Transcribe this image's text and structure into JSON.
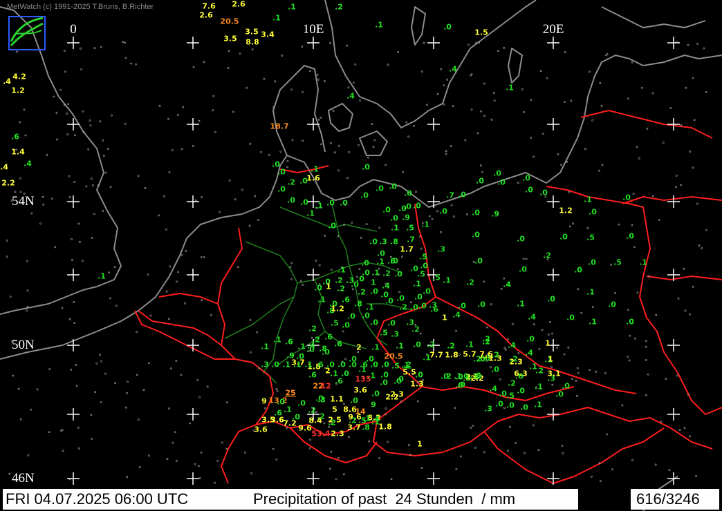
{
  "copyright": "MetWatch  (c) 1991-2025 T.Bruns, B.Richter",
  "footer": {
    "date": "FRI 04.07.2025 06:00 UTC",
    "title": "Precipitation of past  24 Stunden  / mm",
    "station_count": "616/3246"
  },
  "longitude_labels": [
    "0",
    "10E",
    "20E"
  ],
  "latitude_labels": [
    "54N",
    "50N",
    "46N"
  ],
  "colors": {
    "background": "#000000",
    "coastline": "#8c8c8c",
    "borders": "#ff1e1e",
    "german_states": "#1e7a1e",
    "grid": "#ffffff",
    "low_precip": "#22e022",
    "medium_precip": "#ffff33",
    "high_precip": "#ff8c1a",
    "very_high_precip": "#ff3030"
  },
  "stations": [
    {
      "v": "7.6",
      "c": "y"
    },
    {
      "v": "2.6",
      "c": "y"
    },
    {
      "v": "2.6",
      "c": "y"
    },
    {
      "v": "20.5",
      "c": "o"
    },
    {
      "v": "3.5",
      "c": "y"
    },
    {
      "v": "3.4",
      "c": "y"
    },
    {
      "v": "3.5",
      "c": "y"
    },
    {
      "v": "8.8",
      "c": "y"
    },
    {
      "v": ".1",
      "c": "g"
    },
    {
      "v": ".1",
      "c": "g"
    },
    {
      "v": ".2",
      "c": "g"
    },
    {
      "v": ".1",
      "c": "g"
    },
    {
      "v": ".0",
      "c": "g"
    },
    {
      "v": "1.5",
      "c": "y"
    },
    {
      "v": ".4",
      "c": "g"
    },
    {
      "v": ".1",
      "c": "g"
    },
    {
      "v": ".4",
      "c": "g"
    },
    {
      "v": "4.2",
      "c": "y"
    },
    {
      "v": "1.2",
      "c": "y"
    },
    {
      "v": ".4",
      "c": "y"
    },
    {
      "v": ".6",
      "c": "g"
    },
    {
      "v": "1.4",
      "c": "y"
    },
    {
      "v": ".4",
      "c": "g"
    },
    {
      "v": "2.2",
      "c": "y"
    },
    {
      "v": ".4",
      "c": "y"
    },
    {
      "v": "18.7",
      "c": "o"
    },
    {
      "v": ".0",
      "c": "g"
    },
    {
      "v": ".1",
      "c": "g"
    },
    {
      "v": ".0",
      "c": "g"
    },
    {
      "v": ".2",
      "c": "g"
    },
    {
      "v": ".0",
      "c": "g"
    },
    {
      "v": "1.6",
      "c": "y"
    },
    {
      "v": ".0",
      "c": "g"
    },
    {
      "v": ".0",
      "c": "g"
    },
    {
      "v": ".0",
      "c": "g"
    },
    {
      "v": ".1",
      "c": "g"
    },
    {
      "v": ".0",
      "c": "g"
    },
    {
      "v": ".0",
      "c": "g"
    },
    {
      "v": ".1",
      "c": "g"
    },
    {
      "v": ".0",
      "c": "g"
    },
    {
      "v": ".0",
      "c": "g"
    },
    {
      "v": ".0",
      "c": "g"
    },
    {
      "v": ".0",
      "c": "g"
    },
    {
      "v": ".0",
      "c": "g"
    },
    {
      "v": ".0",
      "c": "g"
    },
    {
      "v": ".0",
      "c": "g"
    },
    {
      "v": ".0",
      "c": "g"
    },
    {
      "v": ".0",
      "c": "g"
    },
    {
      "v": ".0",
      "c": "g"
    },
    {
      "v": ".0",
      "c": "g"
    },
    {
      "v": ".0",
      "c": "g"
    },
    {
      "v": ".0",
      "c": "g"
    },
    {
      "v": ".0",
      "c": "g"
    },
    {
      "v": ".0",
      "c": "g"
    },
    {
      "v": ".7",
      "c": "g"
    },
    {
      "v": ".0",
      "c": "g"
    },
    {
      "v": ".0",
      "c": "g"
    },
    {
      "v": ".0",
      "c": "g"
    },
    {
      "v": ".9",
      "c": "g"
    },
    {
      "v": ".0",
      "c": "g"
    },
    {
      "v": ".0",
      "c": "g"
    },
    {
      "v": "1.2",
      "c": "y"
    },
    {
      "v": ".1",
      "c": "g"
    },
    {
      "v": ".0",
      "c": "g"
    },
    {
      "v": ".0",
      "c": "g"
    },
    {
      "v": ".5",
      "c": "g"
    },
    {
      "v": ".0",
      "c": "g"
    },
    {
      "v": ".0",
      "c": "g"
    },
    {
      "v": ".0",
      "c": "g"
    },
    {
      "v": ".0",
      "c": "g"
    },
    {
      "v": ".9",
      "c": "g"
    },
    {
      "v": ".5",
      "c": "g"
    },
    {
      "v": ".1",
      "c": "g"
    },
    {
      "v": ".1",
      "c": "g"
    },
    {
      "v": ".0",
      "c": "g"
    },
    {
      "v": ".3",
      "c": "g"
    },
    {
      "v": ".8",
      "c": "g"
    },
    {
      "v": ".7",
      "c": "g"
    },
    {
      "v": "1.7",
      "c": "y"
    },
    {
      "v": ".3",
      "c": "g"
    },
    {
      "v": ".5",
      "c": "g"
    },
    {
      "v": ".0",
      "c": "g"
    },
    {
      "v": ".1",
      "c": "g"
    },
    {
      "v": ".6",
      "c": "g"
    },
    {
      "v": ".0",
      "c": "g"
    },
    {
      "v": ".0",
      "c": "g"
    },
    {
      "v": ".0",
      "c": "g"
    },
    {
      "v": ".0",
      "c": "g"
    },
    {
      "v": ".0",
      "c": "g"
    },
    {
      "v": ".1",
      "c": "g"
    },
    {
      "v": ".0",
      "c": "g"
    },
    {
      "v": ".2",
      "c": "g"
    },
    {
      "v": ".0",
      "c": "g"
    },
    {
      "v": ".1",
      "c": "g"
    },
    {
      "v": ".2",
      "c": "g"
    },
    {
      "v": ".3",
      "c": "g"
    },
    {
      "v": ".0",
      "c": "g"
    },
    {
      "v": "1",
      "c": "g"
    },
    {
      "v": ".4",
      "c": "g"
    },
    {
      "v": ".5",
      "c": "g"
    },
    {
      "v": ".5",
      "c": "g"
    },
    {
      "v": ".1",
      "c": "g"
    },
    {
      "v": ".2",
      "c": "g"
    },
    {
      "v": ".0",
      "c": "g"
    },
    {
      "v": ".2",
      "c": "g"
    },
    {
      "v": ".0",
      "c": "g"
    },
    {
      "v": ".4",
      "c": "g"
    },
    {
      "v": ".0",
      "c": "g"
    },
    {
      "v": ".0",
      "c": "g"
    },
    {
      "v": "1",
      "c": "y"
    },
    {
      "v": ".2",
      "c": "g"
    },
    {
      "v": ".0",
      "c": "g"
    },
    {
      "v": ".2",
      "c": "g"
    },
    {
      "v": ".0",
      "c": "g"
    },
    {
      "v": ".0",
      "c": "g"
    },
    {
      "v": ".0",
      "c": "g"
    },
    {
      "v": ".1",
      "c": "g"
    },
    {
      "v": ".0",
      "c": "g"
    },
    {
      "v": ".0",
      "c": "g"
    },
    {
      "v": ".0",
      "c": "g"
    },
    {
      "v": ".0",
      "c": "g"
    },
    {
      "v": ".2",
      "c": "g"
    },
    {
      "v": ".0",
      "c": "g"
    },
    {
      "v": ".3",
      "c": "g"
    },
    {
      "v": ".6",
      "c": "g"
    },
    {
      "v": "1",
      "c": "y"
    },
    {
      "v": ".4",
      "c": "g"
    },
    {
      "v": ".0",
      "c": "g"
    },
    {
      "v": ".0",
      "c": "g"
    },
    {
      "v": ".1",
      "c": "g"
    },
    {
      "v": ".0",
      "c": "g"
    },
    {
      "v": ".1",
      "c": "g"
    },
    {
      "v": ".0",
      "c": "g"
    },
    {
      "v": ".8",
      "c": "g"
    },
    {
      "v": ".6",
      "c": "g"
    },
    {
      "v": ".0",
      "c": "g"
    },
    {
      "v": ".1",
      "c": "g"
    },
    {
      "v": ".8",
      "c": "g"
    },
    {
      "v": "1.2",
      "c": "y"
    },
    {
      "v": ".1",
      "c": "g"
    },
    {
      "v": ".0",
      "c": "g"
    },
    {
      "v": ".0",
      "c": "g"
    },
    {
      "v": ".0",
      "c": "g"
    },
    {
      "v": ".3",
      "c": "g"
    },
    {
      "v": ".0",
      "c": "g"
    },
    {
      "v": ".5",
      "c": "g"
    },
    {
      "v": ".0",
      "c": "g"
    },
    {
      "v": ".5",
      "c": "g"
    },
    {
      "v": ".3",
      "c": "g"
    },
    {
      "v": ".2",
      "c": "g"
    },
    {
      "v": ".2",
      "c": "g"
    },
    {
      "v": ".1",
      "c": "g"
    },
    {
      "v": ".0",
      "c": "g"
    },
    {
      "v": ".2",
      "c": "g"
    },
    {
      "v": ".1",
      "c": "g"
    },
    {
      "v": ".2",
      "c": "g"
    },
    {
      "v": ".1",
      "c": "g"
    },
    {
      "v": "2",
      "c": "y"
    },
    {
      "v": ".6",
      "c": "g"
    },
    {
      "v": ".6",
      "c": "g"
    },
    {
      "v": ".2",
      "c": "g"
    },
    {
      "v": ".2",
      "c": "g"
    },
    {
      "v": ".8",
      "c": "g"
    },
    {
      "v": ".4",
      "c": "g"
    },
    {
      "v": ".1",
      "c": "g"
    },
    {
      "v": ".6",
      "c": "g"
    },
    {
      "v": ".1",
      "c": "g"
    },
    {
      "v": ".1",
      "c": "g"
    },
    {
      "v": ".0",
      "c": "g"
    },
    {
      "v": ".0",
      "c": "g"
    },
    {
      "v": ".0",
      "c": "g"
    },
    {
      "v": ".9",
      "c": "g"
    },
    {
      "v": "3.7",
      "c": "y"
    },
    {
      "v": "1.8",
      "c": "y"
    },
    {
      "v": "2",
      "c": "y"
    },
    {
      "v": ".0",
      "c": "g"
    },
    {
      "v": ".1",
      "c": "g"
    },
    {
      "v": ".1",
      "c": "g"
    },
    {
      "v": ".0",
      "c": "g"
    },
    {
      "v": ".1",
      "c": "g"
    },
    {
      "v": ".0",
      "c": "g"
    },
    {
      "v": ".0",
      "c": "g"
    },
    {
      "v": "1.3",
      "c": "y"
    },
    {
      "v": ".0",
      "c": "g"
    },
    {
      "v": ".0",
      "c": "g"
    },
    {
      "v": ".1",
      "c": "g"
    },
    {
      "v": ".0",
      "c": "g"
    },
    {
      "v": ".0",
      "c": "g"
    },
    {
      "v": ".0",
      "c": "g"
    },
    {
      "v": ".0",
      "c": "g"
    },
    {
      "v": ".2",
      "c": "g"
    },
    {
      "v": ".0",
      "c": "g"
    },
    {
      "v": "20.5",
      "c": "o"
    },
    {
      "v": ".5",
      "c": "g"
    },
    {
      "v": "5.5",
      "c": "y"
    },
    {
      "v": ".0",
      "c": "g"
    },
    {
      "v": "2.3",
      "c": "y"
    },
    {
      "v": "2.2",
      "c": "y"
    },
    {
      "v": "3.6",
      "c": "y"
    },
    {
      "v": ".0",
      "c": "g"
    },
    {
      "v": ".0",
      "c": "g"
    },
    {
      "v": ".0",
      "c": "g"
    },
    {
      "v": ".0",
      "c": "g"
    },
    {
      "v": ".2",
      "c": "g"
    },
    {
      "v": ".3",
      "c": "g"
    },
    {
      "v": "1.1",
      "c": "y"
    },
    {
      "v": ".0",
      "c": "g"
    },
    {
      "v": "9",
      "c": "g"
    },
    {
      "v": ".1",
      "c": "g"
    },
    {
      "v": ".6",
      "c": "g"
    },
    {
      "v": "5",
      "c": "y"
    },
    {
      "v": "8.6",
      "c": "y"
    },
    {
      "v": "14",
      "c": "o"
    },
    {
      "v": "3.5",
      "c": "y"
    },
    {
      "v": "3.6",
      "c": "y"
    },
    {
      "v": ".0",
      "c": "g"
    },
    {
      "v": "8.4",
      "c": "y"
    },
    {
      "v": "2.5",
      "c": "y"
    },
    {
      "v": "9.6",
      "c": "y"
    },
    {
      "v": "8.2",
      "c": "y"
    },
    {
      "v": "3.6",
      "c": "y"
    },
    {
      "v": "7.2",
      "c": "y"
    },
    {
      "v": "9.6",
      "c": "y"
    },
    {
      "v": "53.4",
      "c": "r"
    },
    {
      "v": "2.3",
      "c": "y"
    },
    {
      "v": "3.7",
      "c": "y"
    },
    {
      "v": ".8",
      "c": "g"
    },
    {
      "v": "1.8",
      "c": "y"
    },
    {
      "v": "1",
      "c": "y"
    },
    {
      "v": "9",
      "c": "y"
    },
    {
      "v": "13.2",
      "c": "o"
    },
    {
      "v": "25",
      "c": "o",
      "u": true
    },
    {
      "v": "22",
      "c": "o"
    },
    {
      "v": ".6",
      "c": "g"
    },
    {
      "v": "12",
      "c": "r"
    },
    {
      "v": "135",
      "c": "r"
    },
    {
      "v": ".1",
      "c": "g"
    },
    {
      "v": ".0",
      "c": "g"
    },
    {
      "v": ".0",
      "c": "g"
    },
    {
      "v": ".6",
      "c": "g"
    },
    {
      "v": ".0",
      "c": "g"
    },
    {
      "v": ".2",
      "c": "g"
    },
    {
      "v": ".2",
      "c": "g"
    },
    {
      "v": ".2",
      "c": "g"
    },
    {
      "v": ".1",
      "c": "g"
    },
    {
      "v": ".4",
      "c": "g"
    },
    {
      "v": ".1",
      "c": "g"
    },
    {
      "v": ".5",
      "c": "g"
    },
    {
      "v": "2.2",
      "c": "y"
    },
    {
      "v": "2.3",
      "c": "y"
    },
    {
      "v": ".0",
      "c": "g"
    },
    {
      "v": ".3",
      "c": "g"
    },
    {
      "v": ".0",
      "c": "g"
    },
    {
      "v": ".0",
      "c": "g"
    },
    {
      "v": ".0",
      "c": "g"
    },
    {
      "v": ".0",
      "c": "g"
    },
    {
      "v": ".1",
      "c": "g"
    },
    {
      "v": ".0",
      "c": "g"
    },
    {
      "v": ".3",
      "c": "g"
    },
    {
      "v": ".0",
      "c": "g"
    },
    {
      "v": ".2",
      "c": "g"
    },
    {
      "v": ".1",
      "c": "g"
    },
    {
      "v": ".2",
      "c": "g"
    },
    {
      "v": ".1",
      "c": "g"
    },
    {
      "v": "1",
      "c": "y"
    },
    {
      "v": ".0",
      "c": "g"
    },
    {
      "v": ".2",
      "c": "g"
    },
    {
      "v": ".4",
      "c": "g"
    },
    {
      "v": ".5",
      "c": "g"
    },
    {
      "v": ".0",
      "c": "g"
    },
    {
      "v": ".0",
      "c": "g"
    },
    {
      "v": ".1",
      "c": "g"
    },
    {
      "v": ".4",
      "c": "g"
    },
    {
      "v": ".1",
      "c": "g"
    },
    {
      "v": ".0",
      "c": "g"
    },
    {
      "v": ".0",
      "c": "g"
    },
    {
      "v": ".2",
      "c": "g"
    },
    {
      "v": ".4",
      "c": "g"
    },
    {
      "v": ".0",
      "c": "g"
    },
    {
      "v": "1",
      "c": "y"
    },
    {
      "v": ".4",
      "c": "g"
    },
    {
      "v": "2.3",
      "c": "y"
    },
    {
      "v": "6.3",
      "c": "y"
    },
    {
      "v": "3.1",
      "c": "y"
    },
    {
      "v": ".2",
      "c": "g"
    },
    {
      "v": "1.3",
      "c": "y"
    },
    {
      "v": "7.7",
      "c": "y"
    },
    {
      "v": "1.8",
      "c": "y"
    },
    {
      "v": "5.7",
      "c": "y"
    },
    {
      "v": "7.6",
      "c": "y",
      "u": true
    },
    {
      "v": ".1",
      "c": "g"
    },
    {
      "v": ".2",
      "c": "g",
      "u": true
    },
    {
      "v": ".2",
      "c": "g"
    },
    {
      "v": ".1",
      "c": "g"
    },
    {
      "v": ".0",
      "c": "g"
    },
    {
      "v": ".0",
      "c": "g"
    },
    {
      "v": ".0",
      "c": "g"
    },
    {
      "v": ".0",
      "c": "g"
    },
    {
      "v": ".6",
      "c": "g"
    },
    {
      "v": ".0",
      "c": "g"
    },
    {
      "v": ".0",
      "c": "g"
    },
    {
      "v": ".0",
      "c": "g"
    },
    {
      "v": ".6",
      "c": "g"
    },
    {
      "v": ".1",
      "c": "g"
    },
    {
      "v": ".1",
      "c": "g"
    },
    {
      "v": ".1",
      "c": "g"
    },
    {
      "v": ".0",
      "c": "g"
    },
    {
      "v": ".3",
      "c": "g"
    },
    {
      "v": ".0",
      "c": "g"
    },
    {
      "v": ".5",
      "c": "g"
    },
    {
      "v": ".1",
      "c": "g"
    },
    {
      "v": ".1",
      "c": "g"
    }
  ]
}
